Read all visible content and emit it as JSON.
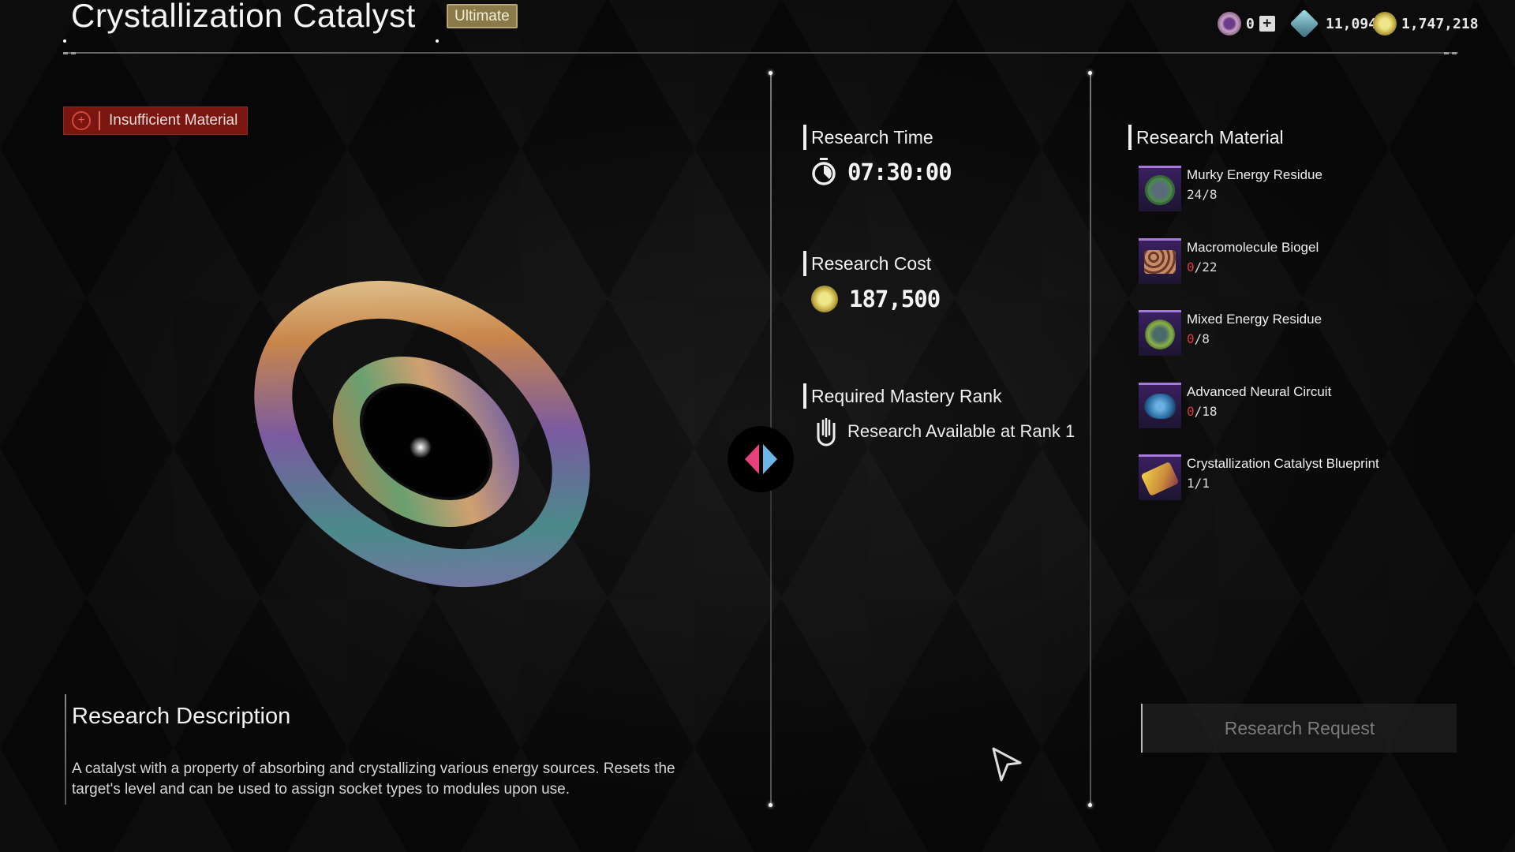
{
  "header": {
    "title": "Crystallization Catalyst",
    "rarity_tag": "Ultimate",
    "currencies": [
      {
        "icon": "ticket-icon",
        "value": "0",
        "has_add_button": true,
        "add_label": "+"
      },
      {
        "icon": "crystal-icon",
        "value": "11,094"
      },
      {
        "icon": "gold-coin-icon",
        "value": "1,747,218"
      }
    ]
  },
  "status": {
    "warning_icon": "warning-icon",
    "warning_text": "Insufficient Material",
    "color": "#7a150f"
  },
  "description": {
    "title": "Research Description",
    "text": "A catalyst with a property of absorbing and crystallizing various energy sources. Resets the target's level and can be used to assign socket types to modules upon use."
  },
  "research": {
    "time_label": "Research Time",
    "time_value": "07:30:00",
    "cost_label": "Research Cost",
    "cost_value": "187,500",
    "rank_label": "Required Mastery Rank",
    "rank_value": "Research Available at Rank 1"
  },
  "materials": {
    "label": "Research Material",
    "items": [
      {
        "name": "Murky Energy Residue",
        "have": "24",
        "need": "8",
        "sufficient": true
      },
      {
        "name": "Macromolecule Biogel",
        "have": "0",
        "need": "22",
        "sufficient": false
      },
      {
        "name": "Mixed Energy Residue",
        "have": "0",
        "need": "8",
        "sufficient": false
      },
      {
        "name": "Advanced Neural Circuit",
        "have": "0",
        "need": "18",
        "sufficient": false
      },
      {
        "name": "Crystallization Catalyst Blueprint",
        "have": "1",
        "need": "1",
        "sufficient": true
      }
    ]
  },
  "actions": {
    "request_label": "Research Request"
  },
  "colors": {
    "swap_left": "#e8407a",
    "swap_right": "#6bb6e6",
    "rarity": "#8a7a4a",
    "lacking": "#d43a3a"
  }
}
